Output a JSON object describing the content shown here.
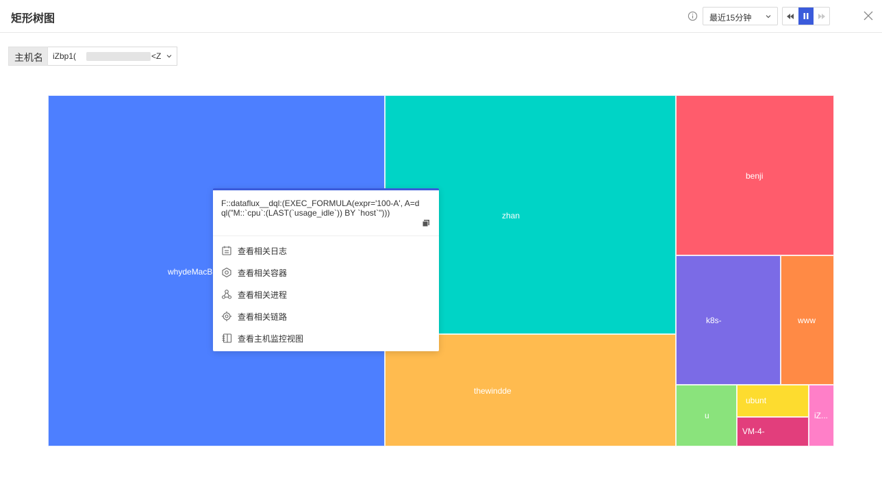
{
  "header": {
    "title": "矩形树图",
    "time_range": "最近15分钟"
  },
  "filter": {
    "label": "主机名",
    "value_prefix": "iZbp1(",
    "value_suffix": "<Z"
  },
  "treemap": {
    "cells": [
      {
        "name": "whydeMacB",
        "color": "#4d7fff"
      },
      {
        "name": "zhan",
        "color": "#00d4c6"
      },
      {
        "name": "thewindde",
        "color": "#ffbb4f"
      },
      {
        "name": "benji",
        "color": "#ff5c6c"
      },
      {
        "name": "k8s-",
        "color": "#7b6be6"
      },
      {
        "name": "www",
        "color": "#ff8a45"
      },
      {
        "name": "u",
        "color": "#8ae37c"
      },
      {
        "name": "ubunt",
        "color": "#fddc2f"
      },
      {
        "name": "VM-4-",
        "color": "#e23e7c"
      },
      {
        "name": "iZ...",
        "color": "#ff7fc8"
      }
    ]
  },
  "context_menu": {
    "query": "F::dataflux__dql:(EXEC_FORMULA(expr='100-A', A=dql(\"M::`cpu`:(LAST(`usage_idle`)) BY `host`\")))",
    "items": [
      {
        "label": "查看相关日志",
        "icon": "log-icon"
      },
      {
        "label": "查看相关容器",
        "icon": "container-icon"
      },
      {
        "label": "查看相关进程",
        "icon": "process-icon"
      },
      {
        "label": "查看相关链路",
        "icon": "trace-icon"
      },
      {
        "label": "查看主机监控视图",
        "icon": "dashboard-icon"
      }
    ]
  }
}
